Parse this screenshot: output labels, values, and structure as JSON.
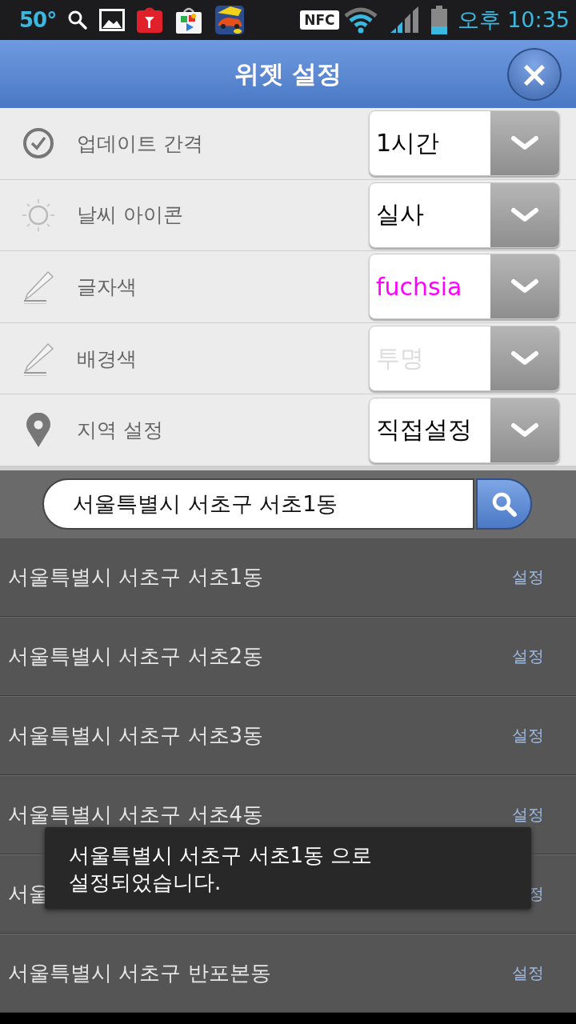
{
  "status_bar": {
    "temperature": "50°",
    "nfc": "NFC",
    "time": "오후 10:35"
  },
  "header": {
    "title": "위젯 설정",
    "close": "×"
  },
  "settings": [
    {
      "kind": "clock",
      "label": "업데이트 간격",
      "value": "1시간",
      "color": "#000000"
    },
    {
      "kind": "sun",
      "label": "날씨 아이콘",
      "value": "실사",
      "color": "#000000"
    },
    {
      "kind": "pencil",
      "label": "글자색",
      "value": "fuchsia",
      "color": "#ff00ff"
    },
    {
      "kind": "pencil",
      "label": "배경색",
      "value": "투명",
      "color": "#dddddd"
    },
    {
      "kind": "pin",
      "label": "지역 설정",
      "value": "직접설정",
      "color": "#000000"
    }
  ],
  "search": {
    "value": "서울특별시 서초구 서초1동"
  },
  "results": [
    {
      "name": "서울특별시 서초구 서초1동",
      "action": "설정"
    },
    {
      "name": "서울특별시 서초구 서초2동",
      "action": "설정"
    },
    {
      "name": "서울특별시 서초구 서초3동",
      "action": "설정"
    },
    {
      "name": "서울특별시 서초구 서초4동",
      "action": "설정"
    },
    {
      "name": "서울",
      "action": "정"
    },
    {
      "name": "서울특별시 서초구 반포본동",
      "action": "설정"
    }
  ],
  "toast": {
    "message": "서울특별시 서초구 서초1동 으로\n설정되었습니다."
  }
}
